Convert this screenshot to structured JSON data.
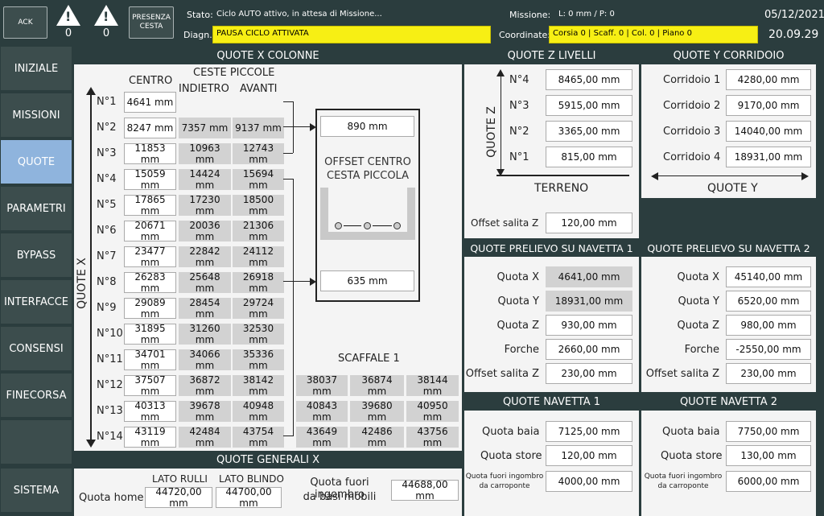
{
  "header": {
    "ack_label": "ACK",
    "warn1_count": "0",
    "warn2_count": "0",
    "presence_label_1": "PRESENZA",
    "presence_label_2": "CESTA",
    "stato_label": "Stato:",
    "stato_value": "Ciclo AUTO attivo, in attesa di Missione...",
    "diagn_label": "Diagn.:",
    "diagn_value": "PAUSA CICLO ATTIVATA",
    "missione_label": "Missione:",
    "missione_value": "L: 0 mm / P: 0",
    "coordinate_label": "Coordinate:",
    "coordinate_value": "Corsia 0 | Scaff. 0 | Col. 0 | Piano 0",
    "date": "05/12/2021",
    "time": "20.09.29"
  },
  "sidebar": {
    "items": [
      "INIZIALE",
      "MISSIONI",
      "QUOTE",
      "PARAMETRI",
      "BYPASS",
      "INTERFACCE",
      "CONSENSI",
      "FINECORSA",
      "",
      "SISTEMA"
    ],
    "active": "QUOTE"
  },
  "quote_x": {
    "title": "QUOTE X COLONNE",
    "col_centro": "CENTRO",
    "col_ceste": "CESTE PICCOLE",
    "col_indietro": "INDIETRO",
    "col_avanti": "AVANTI",
    "axis_label": "QUOTE X",
    "rows": [
      {
        "n": "N°1",
        "centro": "4641 mm",
        "indietro": "",
        "avanti": ""
      },
      {
        "n": "N°2",
        "centro": "8247 mm",
        "indietro": "7357 mm",
        "avanti": "9137 mm"
      },
      {
        "n": "N°3",
        "centro": "11853 mm",
        "indietro": "10963 mm",
        "avanti": "12743 mm"
      },
      {
        "n": "N°4",
        "centro": "15059 mm",
        "indietro": "14424 mm",
        "avanti": "15694 mm"
      },
      {
        "n": "N°5",
        "centro": "17865 mm",
        "indietro": "17230 mm",
        "avanti": "18500 mm"
      },
      {
        "n": "N°6",
        "centro": "20671 mm",
        "indietro": "20036 mm",
        "avanti": "21306 mm"
      },
      {
        "n": "N°7",
        "centro": "23477 mm",
        "indietro": "22842 mm",
        "avanti": "24112 mm"
      },
      {
        "n": "N°8",
        "centro": "26283 mm",
        "indietro": "25648 mm",
        "avanti": "26918 mm"
      },
      {
        "n": "N°9",
        "centro": "29089 mm",
        "indietro": "28454 mm",
        "avanti": "29724 mm"
      },
      {
        "n": "N°10",
        "centro": "31895 mm",
        "indietro": "31260 mm",
        "avanti": "32530 mm"
      },
      {
        "n": "N°11",
        "centro": "34701 mm",
        "indietro": "34066 mm",
        "avanti": "35336 mm"
      },
      {
        "n": "N°12",
        "centro": "37507 mm",
        "indietro": "36872 mm",
        "avanti": "38142 mm"
      },
      {
        "n": "N°13",
        "centro": "40313 mm",
        "indietro": "39678 mm",
        "avanti": "40948 mm"
      },
      {
        "n": "N°14",
        "centro": "43119 mm",
        "indietro": "42484 mm",
        "avanti": "43754 mm"
      }
    ],
    "offset_top": "890 mm",
    "offset_title_1": "OFFSET CENTRO",
    "offset_title_2": "CESTA PICCOLA",
    "offset_bottom": "635 mm",
    "scaffale_title": "SCAFFALE 1",
    "scaffale_rows": [
      [
        "38037 mm",
        "36874 mm",
        "38144 mm"
      ],
      [
        "40843 mm",
        "39680 mm",
        "40950 mm"
      ],
      [
        "43649 mm",
        "42486 mm",
        "43756 mm"
      ]
    ]
  },
  "quote_generali": {
    "title": "QUOTE GENERALI X",
    "lato_rulli": "LATO RULLI",
    "lato_blindo": "LATO BLINDO",
    "quota_home_label": "Quota home",
    "quota_home_rulli": "44720,00 mm",
    "quota_home_blindo": "44700,00 mm",
    "fuori_label_1": "Quota fuori ingombro",
    "fuori_label_2": "da basi mobili",
    "fuori_value": "44688,00 mm"
  },
  "quote_z": {
    "title": "QUOTE Z LIVELLI",
    "axis_label": "QUOTE Z",
    "levels": [
      {
        "label": "N°4",
        "value": "8465,00 mm"
      },
      {
        "label": "N°3",
        "value": "5915,00 mm"
      },
      {
        "label": "N°2",
        "value": "3365,00 mm"
      },
      {
        "label": "N°1",
        "value": "815,00 mm"
      }
    ],
    "terreno": "TERRENO",
    "offset_label": "Offset salita Z",
    "offset_value": "120,00 mm"
  },
  "quote_y": {
    "title": "QUOTE Y CORRIDOIO",
    "items": [
      {
        "label": "Corridoio 1",
        "value": "4280,00 mm"
      },
      {
        "label": "Corridoio 2",
        "value": "9170,00 mm"
      },
      {
        "label": "Corridoio 3",
        "value": "14040,00 mm"
      },
      {
        "label": "Corridoio 4",
        "value": "18931,00 mm"
      }
    ],
    "axis_label": "QUOTE Y"
  },
  "prelievo1": {
    "title": "QUOTE PRELIEVO SU NAVETTA 1",
    "items": [
      {
        "label": "Quota X",
        "value": "4641,00 mm"
      },
      {
        "label": "Quota Y",
        "value": "18931,00 mm"
      },
      {
        "label": "Quota Z",
        "value": "930,00 mm"
      },
      {
        "label": "Forche",
        "value": "2660,00 mm"
      },
      {
        "label": "Offset salita Z",
        "value": "230,00 mm"
      }
    ]
  },
  "prelievo2": {
    "title": "QUOTE PRELIEVO SU NAVETTA 2",
    "items": [
      {
        "label": "Quota X",
        "value": "45140,00 mm"
      },
      {
        "label": "Quota Y",
        "value": "6520,00 mm"
      },
      {
        "label": "Quota Z",
        "value": "980,00 mm"
      },
      {
        "label": "Forche",
        "value": "-2550,00 mm"
      },
      {
        "label": "Offset salita Z",
        "value": "230,00 mm"
      }
    ]
  },
  "navetta1": {
    "title": "QUOTE NAVETTA 1",
    "baia_label": "Quota baia",
    "baia_value": "7125,00 mm",
    "store_label": "Quota store",
    "store_value": "120,00 mm",
    "fuori_label_1": "Quota fuori ingombro",
    "fuori_label_2": "da carroponte",
    "fuori_value": "4000,00 mm"
  },
  "navetta2": {
    "title": "QUOTE NAVETTA 2",
    "baia_label": "Quota baia",
    "baia_value": "7750,00 mm",
    "store_label": "Quota store",
    "store_value": "130,00 mm",
    "fuori_label_1": "Quota fuori ingombro",
    "fuori_label_2": "da carroponte",
    "fuori_value": "6000,00 mm"
  }
}
